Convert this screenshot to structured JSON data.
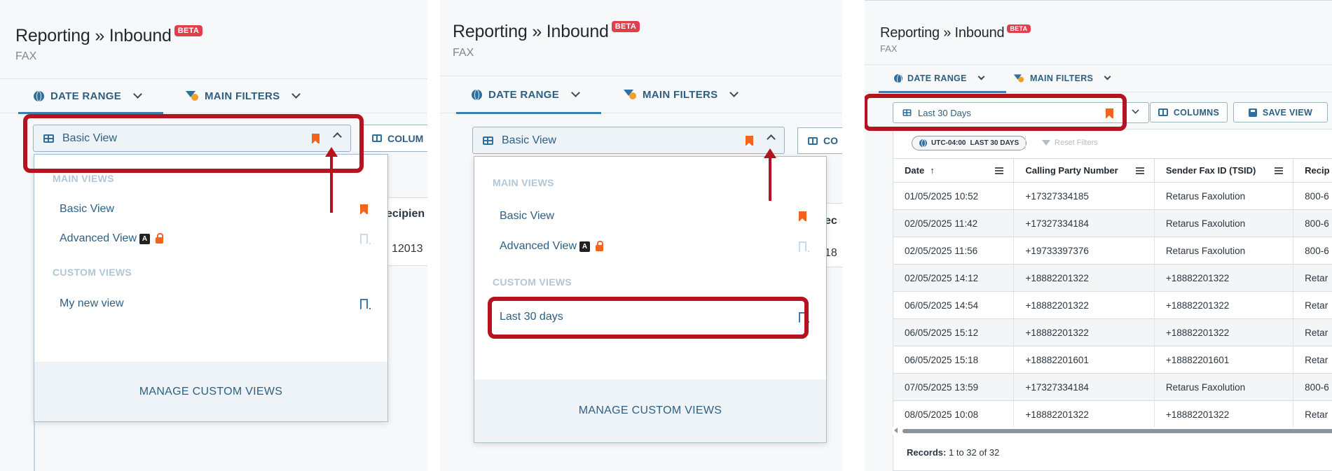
{
  "app": {
    "title": "Reporting » Inbound",
    "beta_badge": "BETA",
    "subtitle": "FAX"
  },
  "tabs": [
    {
      "label": "DATE RANGE",
      "icon": "globe-icon",
      "active": true
    },
    {
      "label": "MAIN FILTERS",
      "icon": "filter-icon",
      "active": false
    }
  ],
  "panel1": {
    "view_selector": {
      "label": "Basic View",
      "expanded": true
    },
    "columns_label": "COLUM",
    "bg_header": "ecipien",
    "bg_value": "12013",
    "dropdown": {
      "main_views_heading": "MAIN VIEWS",
      "main_views": [
        {
          "label": "Basic View",
          "bookmarked": true
        },
        {
          "label": "Advanced View",
          "badge": "A",
          "locked": true,
          "bookmarked": false
        }
      ],
      "custom_views_heading": "CUSTOM VIEWS",
      "custom_views": [
        {
          "label": "My new view",
          "bookmarked": false
        }
      ],
      "manage_label": "MANAGE CUSTOM VIEWS"
    }
  },
  "panel2": {
    "view_selector": {
      "label": "Basic View",
      "expanded": true
    },
    "columns_label": "CO",
    "bg_header": "ec",
    "bg_value": "18",
    "dropdown": {
      "main_views_heading": "MAIN VIEWS",
      "main_views": [
        {
          "label": "Basic View",
          "bookmarked": true
        },
        {
          "label": "Advanced View",
          "badge": "A",
          "locked": true,
          "bookmarked": false
        }
      ],
      "custom_views_heading": "CUSTOM VIEWS",
      "custom_views": [
        {
          "label": "Last 30 days",
          "bookmarked": false
        }
      ],
      "manage_label": "MANAGE CUSTOM VIEWS"
    }
  },
  "panel3": {
    "view_selector": {
      "label": "Last 30 Days"
    },
    "columns_button": "COLUMNS",
    "save_view_button": "SAVE VIEW",
    "timezone_chip": {
      "tz": "UTC-04:00",
      "range": "LAST 30 DAYS"
    },
    "reset_filters": "Reset Filters",
    "table": {
      "columns": [
        "Date",
        "Calling Party Number",
        "Sender Fax ID (TSID)",
        "Recip"
      ],
      "rows": [
        [
          "01/05/2025 10:52",
          "+17327334185",
          "Retarus Faxolution",
          "800-6"
        ],
        [
          "02/05/2025 11:42",
          "+17327334184",
          "Retarus Faxolution",
          "800-6"
        ],
        [
          "02/05/2025 11:56",
          "+19733397376",
          "Retarus Faxolution",
          "800-6"
        ],
        [
          "02/05/2025 14:12",
          "+18882201322",
          "+18882201322",
          "Retar"
        ],
        [
          "06/05/2025 14:54",
          "+18882201322",
          "+18882201322",
          "Retar"
        ],
        [
          "06/05/2025 15:12",
          "+18882201322",
          "+18882201322",
          "Retar"
        ],
        [
          "06/05/2025 15:18",
          "+18882201601",
          "+18882201601",
          "Retar"
        ],
        [
          "07/05/2025 13:59",
          "+17327334184",
          "Retarus Faxolution",
          "800-6"
        ],
        [
          "08/05/2025 10:08",
          "+18882201322",
          "+18882201322",
          "Retar"
        ]
      ]
    },
    "records": {
      "label": "Records:",
      "value": "1 to 32 of 32"
    }
  },
  "colors": {
    "accent": "#2d5f82",
    "highlight": "#b4131f",
    "bookmark": "#f0641e",
    "beta": "#e0404e"
  }
}
